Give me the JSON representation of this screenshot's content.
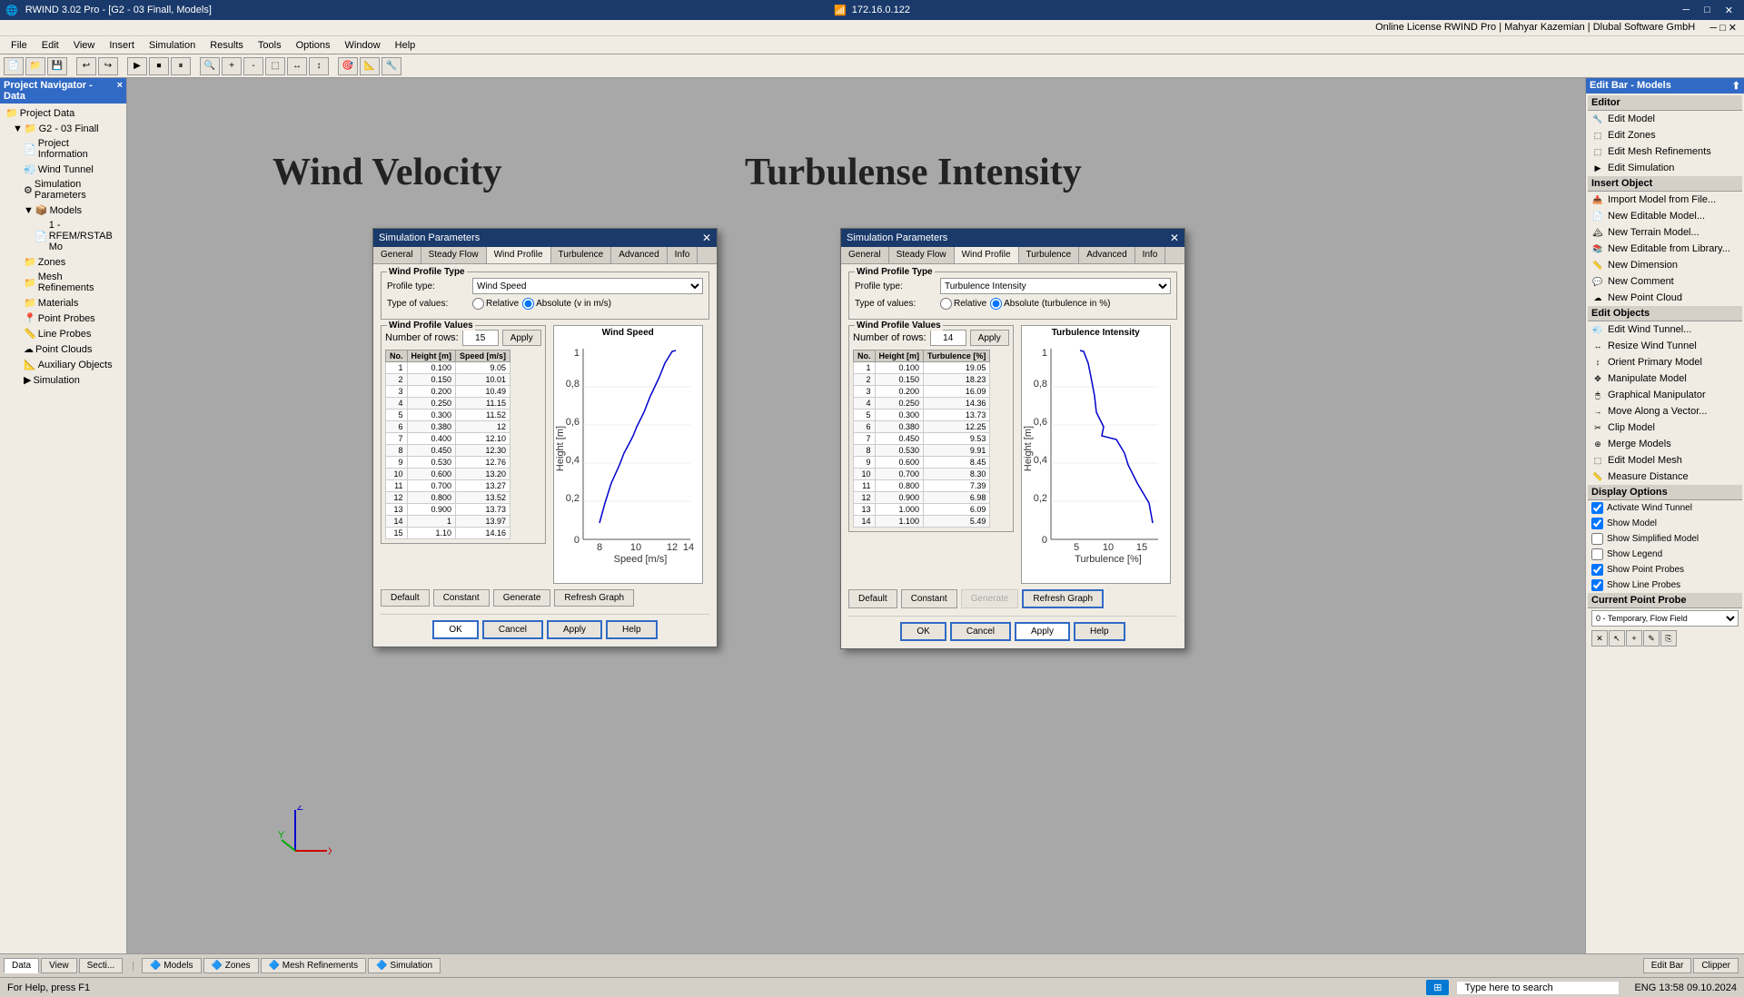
{
  "titlebar": {
    "left": "RWIND 3.02 Pro - [G2 - 03 Finall, Models]",
    "center_icon": "📶",
    "center_ip": "172.16.0.122",
    "license": "Online License RWIND Pro | Mahyar Kazemian | Dlubal Software GmbH"
  },
  "menubar": {
    "items": [
      "File",
      "Edit",
      "View",
      "Insert",
      "Simulation",
      "Results",
      "Tools",
      "Options",
      "Window",
      "Help"
    ]
  },
  "left_panel": {
    "header": "Project Navigator - Data",
    "tree": [
      {
        "label": "Project Data",
        "level": 0,
        "icon": "📁"
      },
      {
        "label": "G2 - 03 Finall",
        "level": 1,
        "icon": "📁"
      },
      {
        "label": "Project Information",
        "level": 2,
        "icon": "📄"
      },
      {
        "label": "Wind Tunnel",
        "level": 2,
        "icon": "💨"
      },
      {
        "label": "Simulation Parameters",
        "level": 2,
        "icon": "⚙"
      },
      {
        "label": "Models",
        "level": 2,
        "icon": "📦"
      },
      {
        "label": "1 - RFEM/RSTAB Mo",
        "level": 3,
        "icon": "📄"
      },
      {
        "label": "Zones",
        "level": 2,
        "icon": "📁"
      },
      {
        "label": "Mesh Refinements",
        "level": 2,
        "icon": "📁"
      },
      {
        "label": "Materials",
        "level": 2,
        "icon": "📁"
      },
      {
        "label": "Point Probes",
        "level": 2,
        "icon": "📍"
      },
      {
        "label": "Line Probes",
        "level": 2,
        "icon": "📏"
      },
      {
        "label": "Point Clouds",
        "level": 2,
        "icon": "☁"
      },
      {
        "label": "Auxiliary Objects",
        "level": 2,
        "icon": "📐"
      },
      {
        "label": "Simulation",
        "level": 2,
        "icon": "▶"
      }
    ]
  },
  "center": {
    "wind_velocity_label": "Wind Velocity",
    "turbulence_label": "Turbulense Intensity"
  },
  "dialog_left": {
    "title": "Simulation Parameters",
    "tabs": [
      "General",
      "Steady Flow",
      "Wind Profile",
      "Turbulence",
      "Advanced",
      "Info"
    ],
    "active_tab": "Wind Profile",
    "wind_profile_type_label": "Wind Profile Type",
    "profile_type_label": "Profile type:",
    "profile_type_value": "Wind Speed",
    "type_of_values_label": "Type of values:",
    "relative_label": "Relative",
    "absolute_label": "Absolute (v in m/s)",
    "absolute_checked": true,
    "wind_profile_values_label": "Wind Profile Values",
    "num_rows_label": "Number of rows:",
    "num_rows_value": "15",
    "apply_rows_label": "Apply",
    "chart_title": "Wind Speed",
    "chart_xlabel": "Speed [m/s]",
    "chart_ylabel": "Height [m]",
    "table_headers": [
      "No.",
      "Height [m]",
      "Speed [m/s]"
    ],
    "table_data": [
      [
        1,
        0.1,
        9.05
      ],
      [
        2,
        0.15,
        10.01
      ],
      [
        3,
        0.2,
        10.49
      ],
      [
        4,
        0.25,
        11.15
      ],
      [
        5,
        0.3,
        11.52
      ],
      [
        6,
        0.38,
        12.0
      ],
      [
        7,
        0.4,
        12.1
      ],
      [
        8,
        0.45,
        12.3
      ],
      [
        9,
        0.53,
        12.76
      ],
      [
        10,
        0.6,
        13.2
      ],
      [
        11,
        0.7,
        13.27
      ],
      [
        12,
        0.8,
        13.52
      ],
      [
        13,
        0.9,
        13.73
      ],
      [
        14,
        1.0,
        13.97
      ],
      [
        15,
        1.1,
        14.16
      ]
    ],
    "buttons": [
      "Default",
      "Constant",
      "Generate",
      "Refresh Graph"
    ],
    "footer_buttons": [
      "OK",
      "Cancel",
      "Apply",
      "Help"
    ]
  },
  "dialog_right": {
    "title": "Simulation Parameters",
    "tabs": [
      "General",
      "Steady Flow",
      "Wind Profile",
      "Turbulence",
      "Advanced",
      "Info"
    ],
    "active_tab": "Wind Profile",
    "wind_profile_type_label": "Wind Profile Type",
    "profile_type_label": "Profile type:",
    "profile_type_value": "Turbulence Intensity",
    "type_of_values_label": "Type of values:",
    "relative_label": "Relative",
    "absolute_label": "Absolute (turbulence in %)",
    "absolute_checked": true,
    "wind_profile_values_label": "Wind Profile Values",
    "num_rows_label": "Number of rows:",
    "num_rows_value": "14",
    "apply_rows_label": "Apply",
    "chart_title": "Turbulence Intensity",
    "chart_xlabel": "Turbulence [%]",
    "chart_ylabel": "Height [m]",
    "table_headers": [
      "No.",
      "Height [m]",
      "Turbulence [%]"
    ],
    "table_data": [
      [
        1,
        0.1,
        19.05
      ],
      [
        2,
        0.15,
        18.23
      ],
      [
        3,
        0.2,
        16.09
      ],
      [
        4,
        0.25,
        14.36
      ],
      [
        5,
        0.3,
        13.73
      ],
      [
        6,
        0.38,
        12.25
      ],
      [
        7,
        0.45,
        9.53
      ],
      [
        8,
        0.53,
        9.91
      ],
      [
        9,
        0.6,
        8.45
      ],
      [
        10,
        0.7,
        8.3
      ],
      [
        11,
        0.8,
        7.39
      ],
      [
        12,
        0.9,
        6.98
      ],
      [
        13,
        1.0,
        6.09
      ],
      [
        14,
        1.1,
        5.49
      ]
    ],
    "buttons": [
      "Default",
      "Constant",
      "Generate",
      "Refresh Graph"
    ],
    "footer_buttons": [
      "OK",
      "Cancel",
      "Apply",
      "Help"
    ]
  },
  "right_panel": {
    "header": "Edit Bar - Models",
    "editor_section": "Editor",
    "editor_items": [
      "Edit Model",
      "Edit Zones",
      "Edit Mesh Refinements",
      "Edit Simulation"
    ],
    "insert_section": "Insert Object",
    "insert_items": [
      "Import Model from File...",
      "New Editable Model...",
      "New Terrain Model...",
      "New Editable from Library...",
      "New Dimension",
      "New Comment",
      "New Point Cloud"
    ],
    "edit_section": "Edit Objects",
    "edit_items": [
      "Edit Wind Tunnel...",
      "Resize Wind Tunnel",
      "Orient Primary Model",
      "Manipulate Model",
      "Graphical Manipulator",
      "Move Along a Vector...",
      "Clip Model",
      "Merge Models",
      "Edit Model Mesh",
      "Measure Distance"
    ],
    "display_section": "Display Options",
    "display_items": [
      {
        "label": "Activate Wind Tunnel",
        "checked": true
      },
      {
        "label": "Show Model",
        "checked": true
      },
      {
        "label": "Show Simplified Model",
        "checked": false
      },
      {
        "label": "Show Legend",
        "checked": false
      },
      {
        "label": "Show Point Probes",
        "checked": true
      },
      {
        "label": "Show Line Probes",
        "checked": true
      }
    ],
    "probe_section": "Current Point Probe",
    "probe_value": "0 - Temporary, Flow Field"
  },
  "bottom_tabs": {
    "nav_tabs": [
      "Data",
      "View",
      "Secti..."
    ],
    "model_tabs": [
      "Models",
      "Zones",
      "Mesh Refinements",
      "Simulation"
    ]
  },
  "statusbar": {
    "left": "For Help, press F1",
    "right_area": "ENG  13:58  09.10.2024"
  }
}
